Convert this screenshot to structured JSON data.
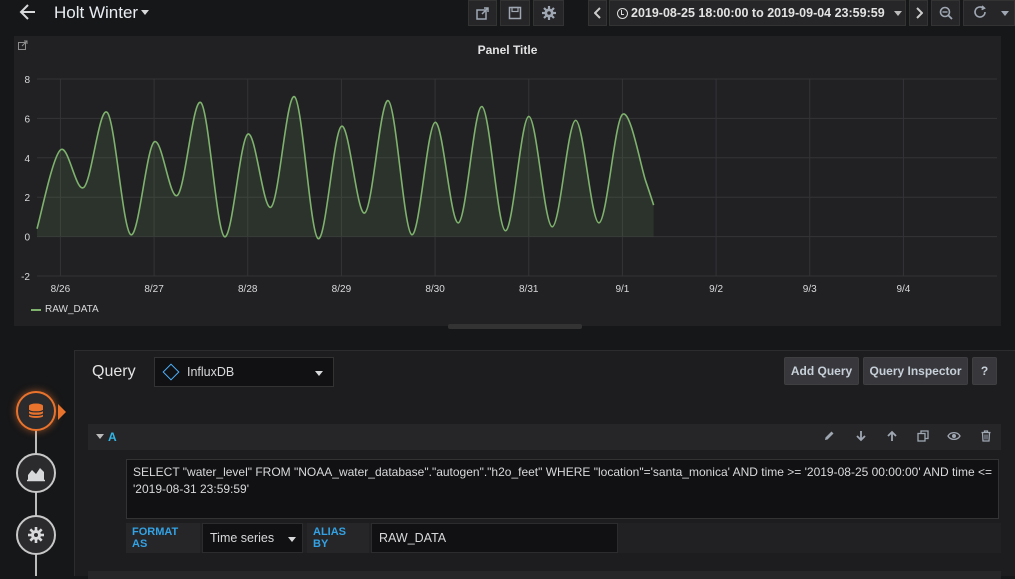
{
  "header": {
    "dashboard_title": "Holt Winter",
    "time_range": "2019-08-25 18:00:00 to 2019-09-04 23:59:59"
  },
  "panel": {
    "title": "Panel Title",
    "legend": [
      {
        "name": "RAW_DATA",
        "color": "#7eb26d"
      }
    ]
  },
  "chart_data": {
    "type": "line",
    "title": "Panel Title",
    "y_ticks": [
      "8",
      "6",
      "4",
      "2",
      "0",
      "-2"
    ],
    "x_ticks": [
      "8/26",
      "8/27",
      "8/28",
      "8/29",
      "8/30",
      "8/31",
      "9/1",
      "9/2",
      "9/3",
      "9/4"
    ],
    "ylim": [
      -2,
      8
    ],
    "xlim": [
      "2019-08-25 18:00",
      "2019-09-04 23:59"
    ],
    "grid": true,
    "legend_position": "bottom-left",
    "series": [
      {
        "name": "RAW_DATA",
        "color": "#7eb26d",
        "fill": true,
        "x": [
          "2019-08-25 18:00",
          "2019-08-26 00:00",
          "2019-08-26 06:00",
          "2019-08-26 12:00",
          "2019-08-26 18:00",
          "2019-08-27 00:00",
          "2019-08-27 06:00",
          "2019-08-27 12:00",
          "2019-08-27 18:00",
          "2019-08-28 00:00",
          "2019-08-28 06:00",
          "2019-08-28 12:00",
          "2019-08-28 18:00",
          "2019-08-29 00:00",
          "2019-08-29 06:00",
          "2019-08-29 12:00",
          "2019-08-29 18:00",
          "2019-08-30 00:00",
          "2019-08-30 06:00",
          "2019-08-30 12:00",
          "2019-08-30 18:00",
          "2019-08-31 00:00",
          "2019-08-31 06:00",
          "2019-08-31 12:00",
          "2019-08-31 18:00",
          "2019-09-01 00:00",
          "2019-09-01 06:00",
          "2019-09-01 08:00"
        ],
        "values": [
          0.4,
          4.4,
          2.5,
          6.3,
          0.1,
          4.8,
          2.1,
          6.8,
          0.0,
          5.2,
          1.5,
          7.1,
          -0.1,
          5.6,
          1.2,
          6.9,
          0.1,
          5.8,
          0.7,
          6.6,
          0.3,
          6.1,
          0.5,
          5.9,
          0.7,
          6.2,
          2.8,
          1.6
        ]
      }
    ]
  },
  "editor": {
    "label": "Query",
    "datasource": "InfluxDB",
    "add_query_label": "Add Query",
    "inspector_label": "Query Inspector",
    "help_label": "?",
    "query_letter": "A",
    "query_text": "SELECT \"water_level\" FROM \"NOAA_water_database\".\"autogen\".\"h2o_feet\" WHERE \"location\"='santa_monica' AND time >= '2019-08-25 00:00:00' AND time <= '2019-08-31 23:59:59'",
    "format_as_label": "FORMAT AS",
    "format_as_value": "Time series",
    "alias_by_label": "ALIAS BY",
    "alias_by_value": "RAW_DATA"
  }
}
